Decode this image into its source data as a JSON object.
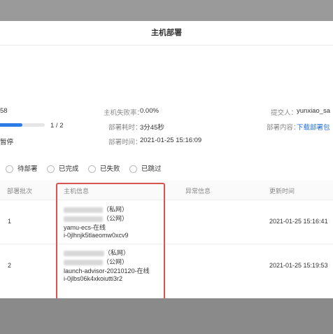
{
  "modal": {
    "title": "主机部署"
  },
  "summary": {
    "host_count_partial": "58",
    "fail_rate_label": "主机失败率：",
    "fail_rate_value": "0.00%",
    "submitter_label": "提交人：",
    "submitter_value": "yunxiao_sa",
    "progress_text": "1 / 2",
    "progress_fraction": 0.5,
    "duration_label": "部署耗时：",
    "duration_value": "3分45秒",
    "content_label": "部署内容：",
    "content_link": "下载部署包",
    "pause_partial": "暂停",
    "time_label": "部署时间：",
    "time_value": "2021-01-25 15:16:09"
  },
  "filters": [
    "待部署",
    "已完成",
    "已失败",
    "已跳过"
  ],
  "table": {
    "headers": [
      "部署批次",
      "主机信息",
      "异常信息",
      "更新时间"
    ],
    "rows": [
      {
        "batch": "1",
        "private_tag": "（私网）",
        "public_tag": "（公网）",
        "name_status": "yamu-ecs-在线",
        "instance_id": "i-0jlhnjk5tlaeomw0xcv9",
        "updated": "2021-01-25 15:16:41"
      },
      {
        "batch": "2",
        "private_tag": "（私网）",
        "public_tag": "（公网）",
        "name_status": "launch-advisor-20210120-在线",
        "instance_id": "i-0jlbs06k4xkoiutti3r2",
        "updated": "2021-01-25 15:19:53"
      }
    ]
  },
  "colors": {
    "accent": "#2d7be5",
    "highlight_border": "#d9534f",
    "link": "#1f6fd6"
  }
}
